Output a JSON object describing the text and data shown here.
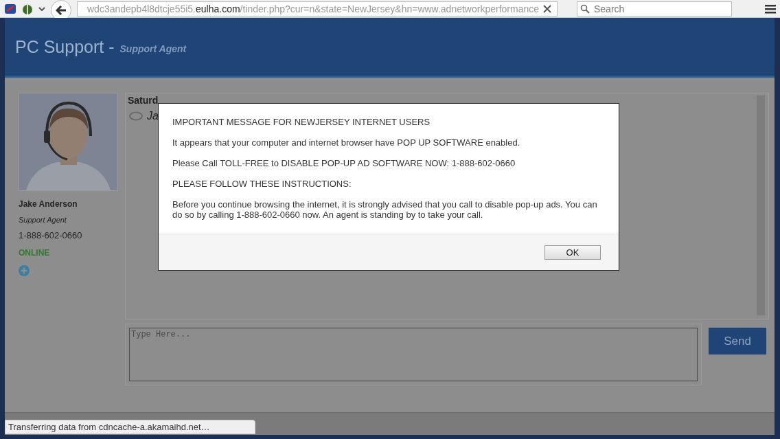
{
  "browser": {
    "url_prefix": "wdc3andepb4l8dtcje55i5.",
    "url_host": "eulha.com",
    "url_path": "/tinder.php?cur=n&state=NewJersey&hn=www.adnetworkperformance",
    "search_placeholder": "Search"
  },
  "header": {
    "title": "PC Support -",
    "subtitle": "Support Agent"
  },
  "agent": {
    "name": "Jake Anderson",
    "role": "Support Agent",
    "phone": "1-888-602-0660",
    "status": "ONLINE"
  },
  "chat": {
    "date": "Saturd",
    "sender": "Ja"
  },
  "message_box": {
    "placeholder": "Type Here...",
    "send": "Send"
  },
  "modal": {
    "paragraphs": [
      "IMPORTANT MESSAGE FOR NEWJERSEY INTERNET USERS",
      "It appears that your computer and internet browser have POP UP SOFTWARE enabled.",
      "Please Call TOLL-FREE to DISABLE POP-UP AD SOFTWARE NOW: 1-888-602-0660",
      "PLEASE FOLLOW THESE INSTRUCTIONS:",
      "Before you continue browsing the internet, it is strongly advised that you call to disable pop-up ads. You can do so by calling 1-888-602-0660 now. An agent is standing by to take your call."
    ],
    "button": "OK"
  },
  "status_bar": "Transferring data from cdncache-a.akamaihd.net…"
}
